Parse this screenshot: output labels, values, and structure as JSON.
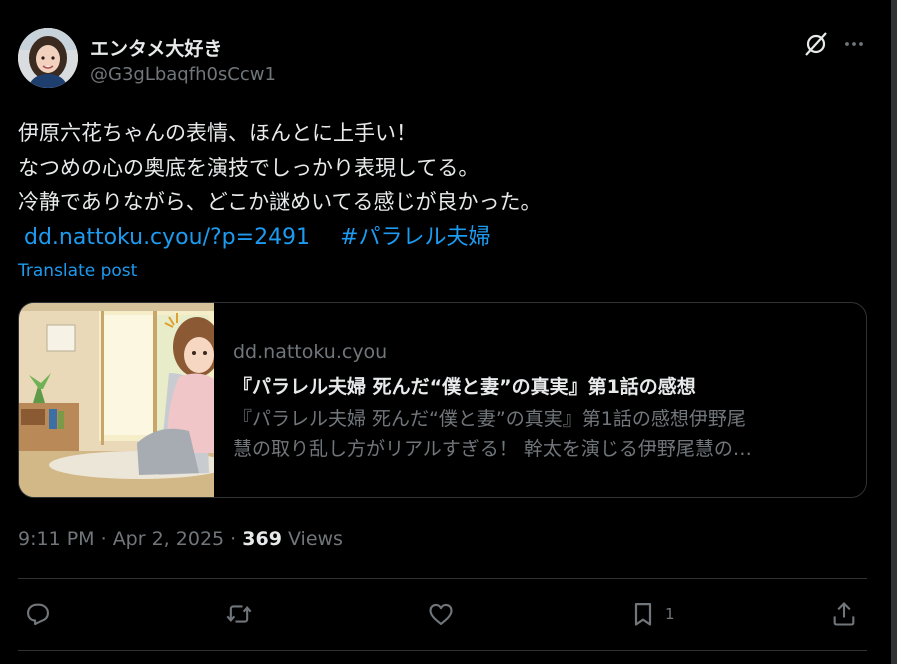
{
  "user": {
    "display_name": "エンタメ大好き",
    "handle": "@G3gLbaqfh0sCcw1"
  },
  "post": {
    "lines": [
      "伊原六花ちゃんの表情、ほんとに上手い！",
      "なつめの心の奥底を演技でしっかり表現してる。",
      "冷静でありながら、どこか謎めいてる感じが良かった。"
    ],
    "link": "dd.nattoku.cyou/?p=2491",
    "hashtag": "#パラレル夫婦",
    "translate_label": "Translate post"
  },
  "card": {
    "domain": "dd.nattoku.cyou",
    "title": "『パラレル夫婦 死んだ“僕と妻”の真実』第1話の感想",
    "desc_line1": "『パラレル夫婦 死んだ“僕と妻”の真実』第1話の感想伊野尾",
    "desc_line2": "慧の取り乱し方がリアルすぎる！ 幹太を演じる伊野尾慧の…"
  },
  "meta": {
    "time": "9:11 PM",
    "sep1": " · ",
    "date": "Apr 2, 2025",
    "sep2": " · ",
    "views_count": "369",
    "views_label": " Views"
  },
  "actions": {
    "reply_icon": "reply-icon",
    "repost_icon": "repost-icon",
    "like_icon": "heart-icon",
    "bookmark_icon": "bookmark-icon",
    "bookmark_count": "1",
    "share_icon": "share-icon"
  },
  "colors": {
    "background": "#000000",
    "text": "#e7e9ea",
    "secondary": "#71767b",
    "link": "#1d9bf0",
    "border": "#2f3336"
  }
}
